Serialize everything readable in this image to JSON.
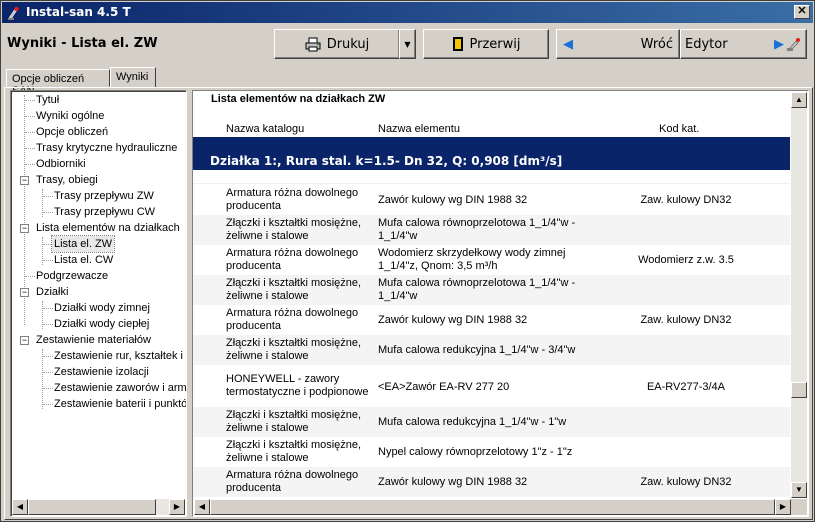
{
  "app": {
    "title": "Instal-san 4.5 T",
    "close_glyph": "✕"
  },
  "header": {
    "page_title": "Wyniki - Lista el. ZW",
    "print_label": "Drukuj",
    "dropdown_glyph": "▼",
    "stop_label": "Przerwij",
    "back_label": "Wróć",
    "editor_label": "Edytor",
    "back_arrow_glyph": "◀",
    "editor_arrow_glyph": "▶"
  },
  "tabs": [
    {
      "label": "Opcje obliczeń SAN"
    },
    {
      "label": "Wyniki"
    }
  ],
  "tree": {
    "items": [
      {
        "label": "Tytuł"
      },
      {
        "label": "Wyniki ogólne"
      },
      {
        "label": "Opcje obliczeń"
      },
      {
        "label": "Trasy krytyczne hydrauliczne"
      },
      {
        "label": "Odbiorniki"
      },
      {
        "label": "Trasy, obiegi"
      },
      {
        "label": "Trasy przepływu ZW"
      },
      {
        "label": "Trasy przepływu CW"
      },
      {
        "label": "Lista elementów na działkach"
      },
      {
        "label": "Lista el. ZW"
      },
      {
        "label": "Lista el. CW"
      },
      {
        "label": "Podgrzewacze"
      },
      {
        "label": "Działki"
      },
      {
        "label": "Działki wody zimnej"
      },
      {
        "label": "Działki wody ciepłej"
      },
      {
        "label": "Zestawienie materiałów"
      },
      {
        "label": "Zestawienie rur, kształtek i"
      },
      {
        "label": "Zestawienie izolacji"
      },
      {
        "label": "Zestawienie zaworów i arma"
      },
      {
        "label": "Zestawienie baterii i punktó"
      }
    ],
    "minus_glyph": "−",
    "scroll_left": "◀",
    "scroll_right": "▶"
  },
  "grid": {
    "title": "Lista elementów na działkach ZW",
    "columns": [
      "Nazwa katalogu",
      "Nazwa elementu",
      "Kod kat."
    ],
    "section_header": "Działka 1:, Rura stal. k=1.5- Dn 32, Q: 0,908 [dm³/s]",
    "rows": [
      {
        "catalog": "Armatura różna dowolnego producenta",
        "element": "Zawór kulowy wg DIN 1988 32",
        "code": "Zaw. kulowy DN32"
      },
      {
        "catalog": "Złączki i kształtki mosiężne, żeliwne i stalowe",
        "element": "Mufa calowa równoprzelotowa 1_1/4\"w - 1_1/4\"w",
        "code": ""
      },
      {
        "catalog": "Armatura różna dowolnego producenta",
        "element": "Wodomierz skrzydełkowy wody zimnej 1_1/4\"z, Qnom: 3,5 m³/h",
        "code": "Wodomierz z.w. 3.5"
      },
      {
        "catalog": "Złączki i kształtki mosiężne, żeliwne i stalowe",
        "element": "Mufa calowa równoprzelotowa 1_1/4\"w - 1_1/4\"w",
        "code": ""
      },
      {
        "catalog": "Armatura różna dowolnego producenta",
        "element": "Zawór kulowy wg DIN 1988 32",
        "code": "Zaw. kulowy DN32"
      },
      {
        "catalog": "Złączki i kształtki mosiężne, żeliwne i stalowe",
        "element": "Mufa calowa redukcyjna 1_1/4\"w - 3/4\"w",
        "code": ""
      },
      {
        "catalog": "HONEYWELL - zawory termostatyczne i podpionowe",
        "element": "<EA>Zawór EA-RV 277 20",
        "code": "EA-RV277-3/4A"
      },
      {
        "catalog": "Złączki i kształtki mosiężne, żeliwne i stalowe",
        "element": "Mufa calowa redukcyjna 1_1/4\"w - 1\"w",
        "code": ""
      },
      {
        "catalog": "Złączki i kształtki mosiężne, żeliwne i stalowe",
        "element": "Nypel calowy równoprzelotowy 1\"z - 1\"z",
        "code": ""
      },
      {
        "catalog": "Armatura różna dowolnego producenta",
        "element": "Zawór kulowy wg DIN 1988 32",
        "code": "Zaw. kulowy DN32"
      }
    ],
    "scroll_up": "▲",
    "scroll_down": "▼",
    "scroll_left": "◀",
    "scroll_right": "▶"
  },
  "colors": {
    "titlebar": "#0a246a",
    "section_band": "#0a246a",
    "accent_arrow": "#1a6fd8"
  }
}
